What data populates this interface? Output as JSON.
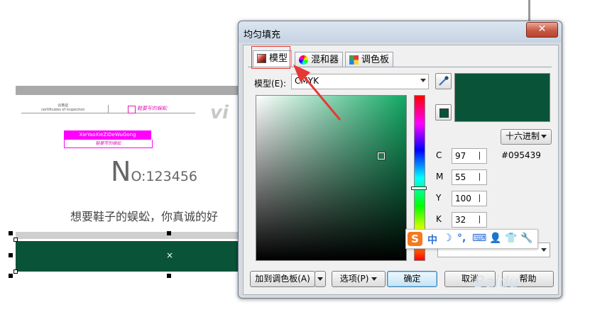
{
  "document": {
    "cert_small_line1": "合格证",
    "cert_small_line2": "certificates of inspection",
    "cert_signature": "鞋要写的蜈蚣",
    "brand_logo": "vi",
    "pink_banner": "XieYaoXieZiDeWuGong",
    "pink_signature": "鞋要写的蜈蚣",
    "no_big": "N",
    "no_rest": "O:123456",
    "slogan": "想要鞋子的蜈蚣，你真诚的好",
    "fill_color": "#095439"
  },
  "dialog": {
    "title": "均匀填充",
    "close_symbol": "✕",
    "tabs": [
      {
        "label": "模型",
        "icon": "color-model-icon",
        "active": true
      },
      {
        "label": "混和器",
        "icon": "color-wheel-icon",
        "active": false
      },
      {
        "label": "调色板",
        "icon": "palette-grid-icon",
        "active": false
      }
    ],
    "model_label": "模型(E):",
    "model_value": "CMYK",
    "preview_color": "#095439",
    "hue_colors": [
      "#ff0000",
      "#ff00ff",
      "#0000ff",
      "#00ffff",
      "#00ff00",
      "#ffff00"
    ],
    "cmyk": [
      {
        "label": "C",
        "value": "97"
      },
      {
        "label": "M",
        "value": "55"
      },
      {
        "label": "Y",
        "value": "100"
      },
      {
        "label": "K",
        "value": "32"
      }
    ],
    "hex_button": "十六进制",
    "hex_value": "#095439",
    "buttons": {
      "add_palette": "加到调色板(A)",
      "options": "选项(P)",
      "ok": "确定",
      "cancel": "取消",
      "help": "帮助"
    }
  },
  "ime_toolbar": {
    "logo": "S",
    "mode": "中",
    "icons": [
      "moon-icon",
      "punctuation-icon",
      "keyboard-icon",
      "user-icon",
      "shirt-icon",
      "wrench-icon"
    ]
  },
  "accent_colors": {
    "annotation_red": "#e53935",
    "brand_pink": "#ff00ff"
  }
}
